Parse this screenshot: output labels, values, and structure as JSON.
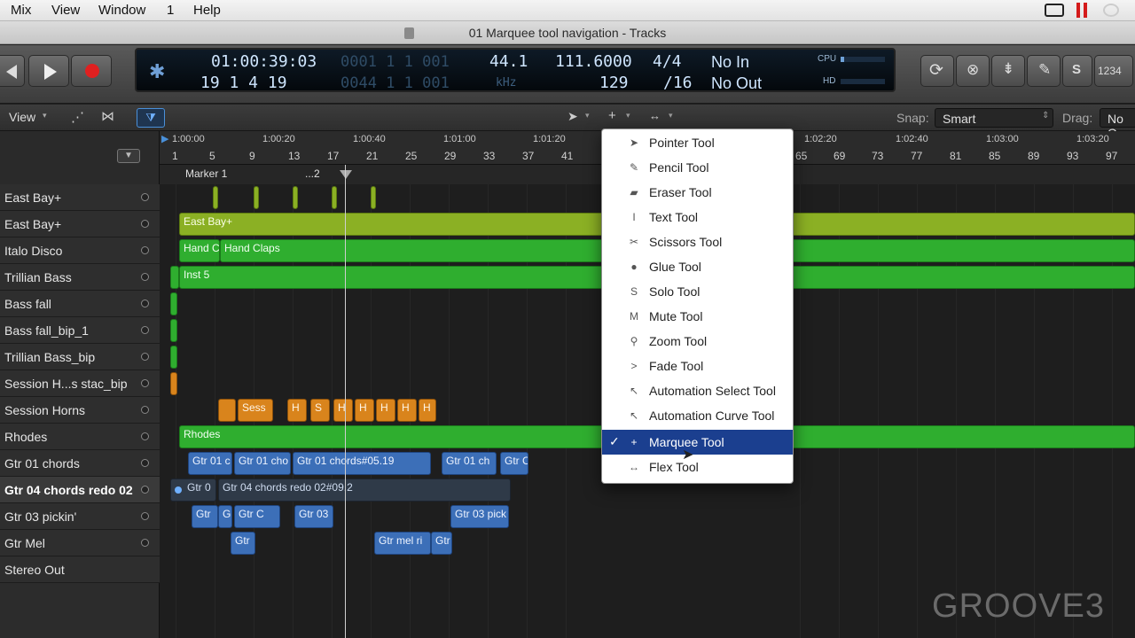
{
  "menubar": {
    "items": [
      "Mix",
      "View",
      "Window",
      "1",
      "Help"
    ]
  },
  "window": {
    "title": "01 Marquee tool navigation - Tracks"
  },
  "lcd": {
    "timecode": "01:00:39:03",
    "position_bars": "19  1  4   19",
    "ghost_top": "0001  1  1  001",
    "ghost_bottom": "0044  1  1  001",
    "sample_rate": "44.1",
    "sample_unit": "kHz",
    "tempo": "111.6000",
    "tempo_sub": "129",
    "signature": "4/4",
    "division": "/16",
    "in_label": "No In",
    "out_label": "No Out",
    "cpu_label": "CPU",
    "hd_label": "HD",
    "counter_label": "1234"
  },
  "tracksbar": {
    "view_label": "View",
    "snap_label": "Snap:",
    "snap_value": "Smart",
    "drag_label": "Drag:",
    "drag_value": "No O"
  },
  "ruler": {
    "times": [
      "1:00:00",
      "1:00:20",
      "1:00:40",
      "1:01:00",
      "1:01:20",
      "1:02:20",
      "1:02:40",
      "1:03:00",
      "1:03:20"
    ],
    "bars": [
      "1",
      "5",
      "9",
      "13",
      "17",
      "21",
      "25",
      "29",
      "33",
      "37",
      "41",
      "65",
      "69",
      "73",
      "77",
      "81",
      "85",
      "89",
      "93",
      "97"
    ],
    "markers": [
      "Marker 1",
      "...2"
    ]
  },
  "tracks": [
    {
      "name": "East Bay+",
      "selected": false
    },
    {
      "name": "East Bay+",
      "selected": false
    },
    {
      "name": "Italo Disco",
      "selected": false
    },
    {
      "name": "Trillian Bass",
      "selected": false
    },
    {
      "name": "Bass fall",
      "selected": false
    },
    {
      "name": "Bass fall_bip_1",
      "selected": false
    },
    {
      "name": "Trillian Bass_bip",
      "selected": false
    },
    {
      "name": "Session H...s stac_bip",
      "selected": false
    },
    {
      "name": "Session Horns",
      "selected": false
    },
    {
      "name": "Rhodes",
      "selected": false
    },
    {
      "name": "Gtr 01 chords",
      "selected": false
    },
    {
      "name": "Gtr 04 chords redo 02",
      "selected": true
    },
    {
      "name": "Gtr 03 pickin'",
      "selected": false
    },
    {
      "name": "Gtr Mel",
      "selected": false
    },
    {
      "name": "Stereo Out",
      "selected": false
    }
  ],
  "regions": {
    "east_bay": "East Bay+",
    "hand_1": "Hand C",
    "hand_2": "Hand Claps",
    "inst5": "Inst 5",
    "rhodes": "Rhodes",
    "sess": "Sess",
    "horns_h": "H",
    "horns_s": "S",
    "gtr01_a": "Gtr 01 c",
    "gtr01_b": "Gtr 01 cho",
    "gtr01_c": "Gtr 01 chords#05.19",
    "gtr01_d": "Gtr 01 ch",
    "gtr01_e": "Gtr C",
    "gtr04_a": "Gtr 0",
    "gtr04_b": "Gtr 04 chords redo 02#09.2",
    "gtr03_a": "Gtr",
    "gtr03_b": "G",
    "gtr03_c": "Gtr C",
    "gtr03_d": "Gtr 03",
    "gtr03_e": "Gtr 03 pick",
    "gtrmel_a": "Gtr",
    "gtrmel_b": "Gtr mel ri"
  },
  "tool_menu": {
    "items": [
      {
        "label": "Pointer Tool",
        "icon": "pointer-icon",
        "glyph": "➤"
      },
      {
        "label": "Pencil Tool",
        "icon": "pencil-icon",
        "glyph": "✎"
      },
      {
        "label": "Eraser Tool",
        "icon": "eraser-icon",
        "glyph": "▰"
      },
      {
        "label": "Text Tool",
        "icon": "text-cursor-icon",
        "glyph": "I"
      },
      {
        "label": "Scissors Tool",
        "icon": "scissors-icon",
        "glyph": "✂"
      },
      {
        "label": "Glue Tool",
        "icon": "glue-icon",
        "glyph": "●"
      },
      {
        "label": "Solo Tool",
        "icon": "solo-icon",
        "glyph": "S"
      },
      {
        "label": "Mute Tool",
        "icon": "mute-icon",
        "glyph": "M"
      },
      {
        "label": "Zoom Tool",
        "icon": "zoom-icon",
        "glyph": "⚲"
      },
      {
        "label": "Fade Tool",
        "icon": "fade-icon",
        "glyph": ">"
      },
      {
        "label": "Automation Select Tool",
        "icon": "automation-select-icon",
        "glyph": "↖"
      },
      {
        "label": "Automation Curve Tool",
        "icon": "automation-curve-icon",
        "glyph": "↖"
      },
      {
        "label": "Marquee Tool",
        "icon": "marquee-crosshair-icon",
        "glyph": "+"
      },
      {
        "label": "Flex Tool",
        "icon": "flex-icon",
        "glyph": "↔"
      }
    ],
    "selected_index": 12,
    "check_glyph": "✓"
  },
  "watermark": "GROOVE3",
  "colors": {
    "region_green": "#2fae2f",
    "region_lime": "#8bb024",
    "region_blue": "#3c6fb8",
    "region_orange": "#d9841c",
    "menu_highlight": "#1b3f8f",
    "record_red": "#e02020"
  }
}
